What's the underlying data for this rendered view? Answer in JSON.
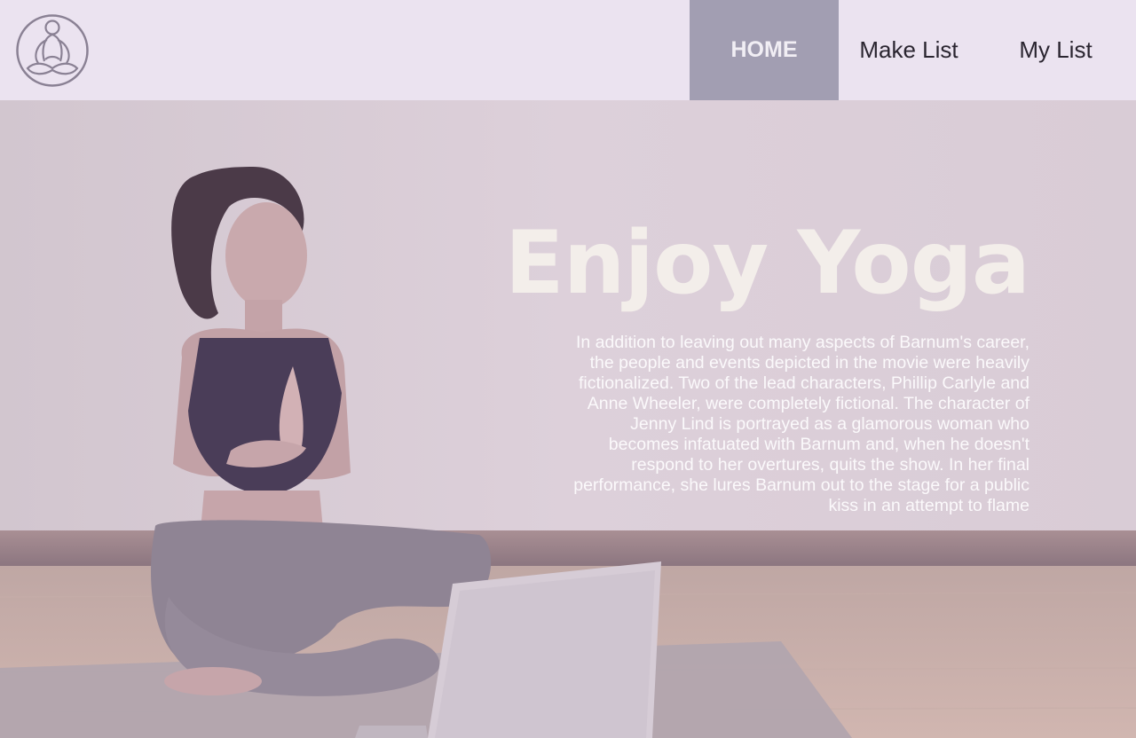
{
  "brand": {
    "logo_icon": "meditation-figure-icon"
  },
  "nav": {
    "items": [
      {
        "label": "HOME",
        "active": true
      },
      {
        "label": "Make List",
        "active": false
      },
      {
        "label": "My List",
        "active": false
      }
    ]
  },
  "hero": {
    "title": "Enjoy Yoga",
    "body": "In addition to leaving out many aspects of Barnum's career, the people and events depicted in the movie were heavily fictionalized. Two of the lead characters, Phillip Carlyle and Anne Wheeler, were completely fictional. The character of Jenny Lind is portrayed as a glamorous woman who becomes infatuated with Barnum and, when he doesn't respond to her overtures, quits the show. In her final performance, she lures Barnum out to the stage for a public kiss in an attempt to flame",
    "image": "woman-meditating-with-laptop-photo"
  },
  "colors": {
    "navbar_bg": "#ebe3f0",
    "active_nav_bg": "#a29eb2",
    "hero_overlay": "#dccdd8",
    "hero_text": "#f3eeea"
  }
}
